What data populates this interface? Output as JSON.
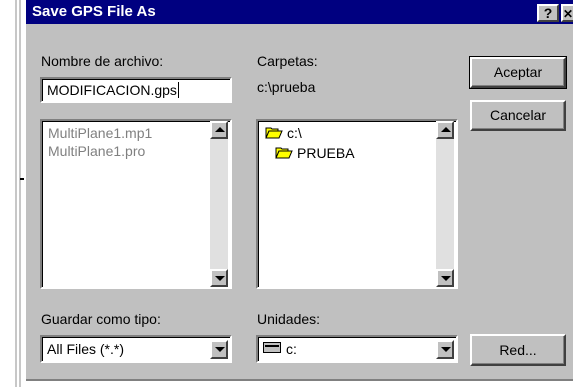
{
  "window": {
    "title": "Save GPS File As",
    "help_label": "?",
    "close_label": "✕"
  },
  "filename": {
    "label": "Nombre de archivo:",
    "value": "MODIFICACION.gps"
  },
  "files": {
    "items": [
      "MultiPlane1.mp1",
      "MultiPlane1.pro"
    ]
  },
  "folders": {
    "label": "Carpetas:",
    "path": "c:\\prueba",
    "items": [
      "c:\\",
      "PRUEBA"
    ]
  },
  "buttons": {
    "accept": "Aceptar",
    "cancel": "Cancelar",
    "network": "Red..."
  },
  "save_type": {
    "label": "Guardar como tipo:",
    "value": "All Files (*.*)"
  },
  "drives": {
    "label": "Unidades:",
    "value": "c:"
  },
  "colors": {
    "titlebar": "#000080",
    "face": "#c0c0c0",
    "folder": "#ffff00"
  },
  "icons": [
    "folder-open-icon",
    "drive-icon",
    "help-icon",
    "close-icon"
  ]
}
